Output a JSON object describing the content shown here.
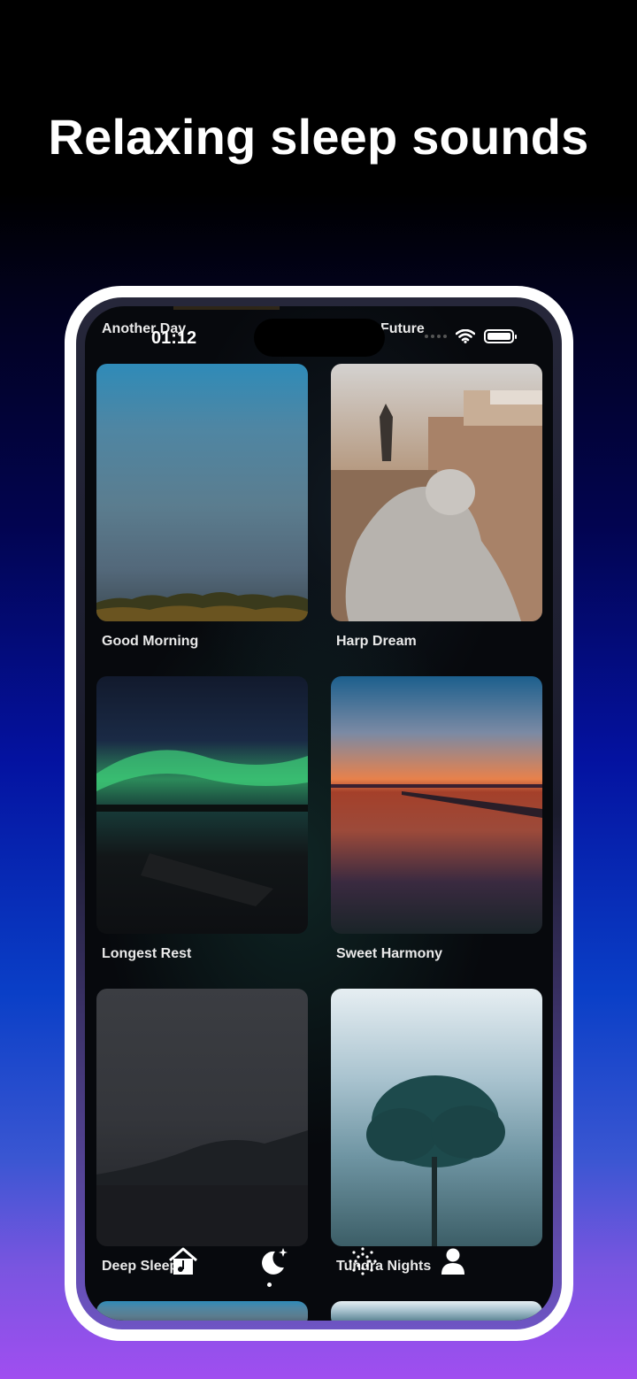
{
  "headline": {
    "prefix": "Relaxing",
    "bold": "sleep",
    "suffix": "sounds"
  },
  "status_bar": {
    "time": "01:12"
  },
  "partial_top_cards": [
    {
      "title": "Another Day"
    },
    {
      "title": "Future"
    }
  ],
  "sounds": [
    {
      "title": "Good Morning",
      "art": "morning-sky-with-treeline"
    },
    {
      "title": "Harp Dream",
      "art": "statue-and-palace"
    },
    {
      "title": "Longest Rest",
      "art": "aurora-over-lake"
    },
    {
      "title": "Sweet Harmony",
      "art": "sunset-over-water-pier"
    },
    {
      "title": "Deep Sleep",
      "art": "starry-night-over-mountains"
    },
    {
      "title": "Tundra Nights",
      "art": "lone-tree-in-fog"
    }
  ],
  "tab_bar": [
    {
      "name": "home",
      "icon": "home-music-icon"
    },
    {
      "name": "sleep",
      "icon": "moon-stars-icon",
      "active": true
    },
    {
      "name": "breathe",
      "icon": "dots-flower-icon"
    },
    {
      "name": "profile",
      "icon": "person-icon"
    }
  ],
  "colors": {
    "background_top": "#000000",
    "background_mid": "#0412a0",
    "background_bottom": "#a04ef0",
    "frame": "#ffffff",
    "screen": "#07090d"
  }
}
